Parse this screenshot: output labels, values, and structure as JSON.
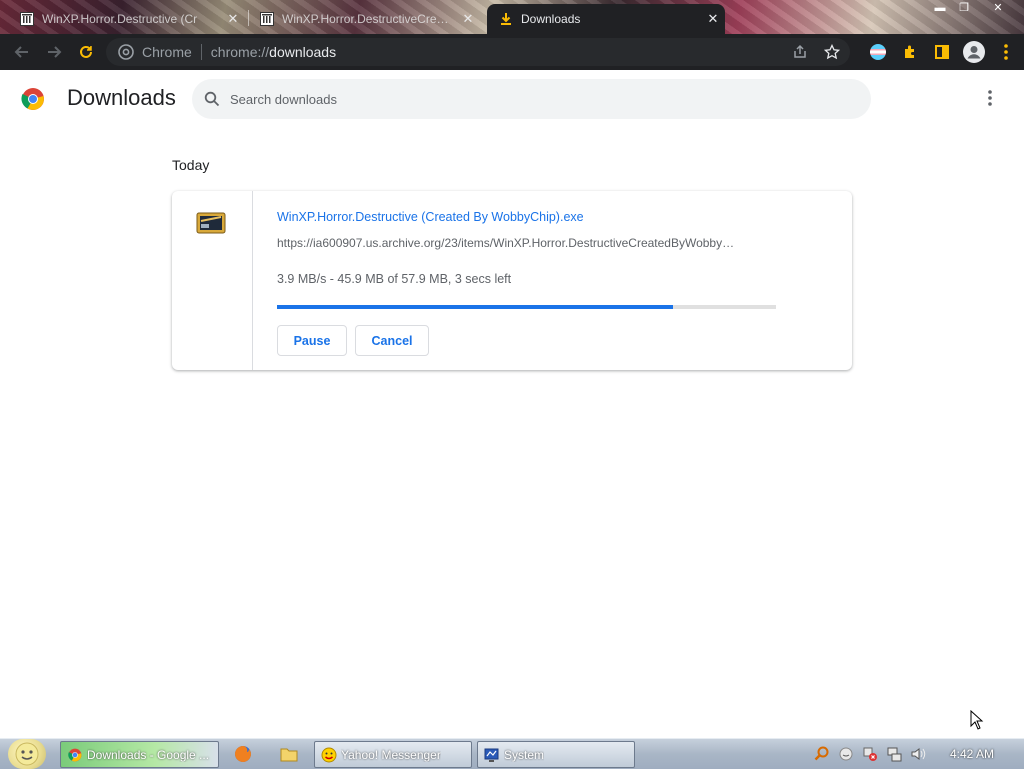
{
  "tabs": [
    {
      "title": "WinXP.Horror.Destructive (Cr",
      "close": "✕"
    },
    {
      "title": "WinXP.Horror.DestructiveCreate",
      "close": "✕"
    },
    {
      "title": "Downloads",
      "close": "✕"
    }
  ],
  "omnibox": {
    "site": "Chrome",
    "scheme": "chrome://",
    "path": "downloads"
  },
  "downloads": {
    "title": "Downloads",
    "search_placeholder": "Search downloads",
    "section": "Today",
    "item": {
      "filename": "WinXP.Horror.Destructive (Created By WobbyChip).exe",
      "url": "https://ia600907.us.archive.org/23/items/WinXP.Horror.DestructiveCreatedByWobby…",
      "status": "3.9 MB/s - 45.9 MB of 57.9 MB, 3 secs left",
      "progress_fraction": 0.793,
      "pause_label": "Pause",
      "cancel_label": "Cancel"
    }
  },
  "taskbar": {
    "tasks": [
      {
        "label": "Downloads - Google ..."
      },
      {
        "label": "Yahoo! Messenger"
      },
      {
        "label": "System"
      }
    ],
    "clock": "4:42 AM"
  },
  "colors": {
    "accent": "#1a73e8",
    "toolbar": "#202124",
    "omnibox": "#282a2d"
  }
}
